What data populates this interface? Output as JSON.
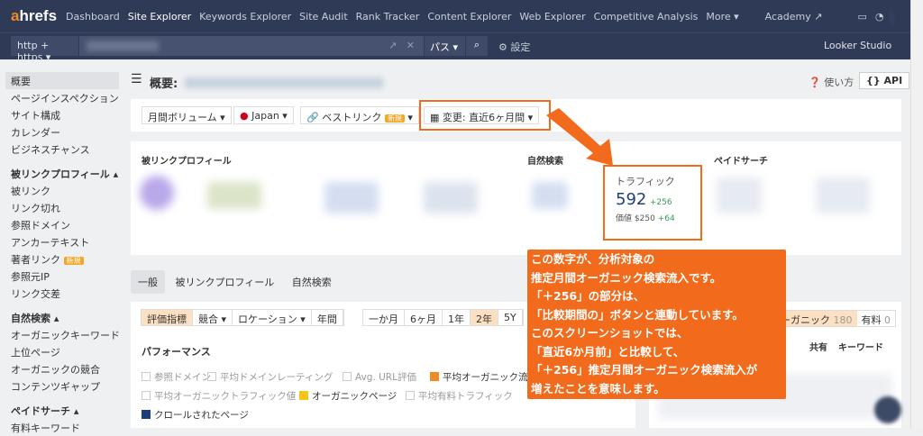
{
  "nav": {
    "logo_a": "a",
    "logo_rest": "hrefs",
    "items": [
      "Dashboard",
      "Site Explorer",
      "Keywords Explorer",
      "Site Audit",
      "Rank Tracker",
      "Content Explorer",
      "Web Explorer",
      "Competitive Analysis",
      "More ▾"
    ],
    "academy": "Academy ↗"
  },
  "search": {
    "protocol": "http + https ▾",
    "path": "パス ▾",
    "search_icon": "search-icon",
    "settings": "⚙ 設定",
    "looker": "Looker Studio"
  },
  "sidebar": {
    "items": [
      "概要",
      "ページインスペクション",
      "サイト構成",
      "カレンダー",
      "ビジネスチャンス"
    ],
    "backlinks_head": "被リンクプロフィール ▴",
    "backlinks": [
      "被リンク",
      "リンク切れ",
      "参照ドメイン",
      "アンカーテキスト",
      "著者リンク",
      "参照元IP",
      "リンク交差"
    ],
    "new_badge": "新規",
    "organic_head": "自然検索 ▴",
    "organic": [
      "オーガニックキーワード",
      "上位ページ",
      "オーガニックの競合",
      "コンテンツギャップ"
    ],
    "paid_head": "ペイドサーチ ▴",
    "paid": [
      "有料キーワード"
    ]
  },
  "header": {
    "title": "概要:",
    "help": "使い方",
    "api": "{} API"
  },
  "filters": {
    "volume": "月間ボリューム ▾",
    "country": "Japan ▾",
    "best_links": "ベストリンク",
    "best_badge": "新規",
    "compare": "変更: 直近6ヶ月間 ▾"
  },
  "cards": {
    "backlinks": "被リンクプロフィール",
    "organic": "自然検索",
    "paid": "ペイドサーチ",
    "traffic_label": "トラフィック",
    "traffic_value": "592",
    "traffic_delta": "+256",
    "value_label": "価値",
    "value_amount": "$250",
    "value_delta": "+64"
  },
  "callout": "この数字が、分析対象の\n推定月間オーガニック検索流入です。\n「＋256」の部分は、\n「比較期間の」ボタンと連動しています。\nこのスクリーンショットでは、\n「直近6か月前」と比較して、\n「＋256」推定月間オーガニック検索流入が\n増えたことを意味します。",
  "tabs": [
    "一般",
    "被リンクプロフィール",
    "自然検索"
  ],
  "controls": {
    "left": [
      "評価指標",
      "競合 ▾",
      "ロケーション ▾",
      "年間"
    ],
    "periods": [
      "一か月",
      "6ヶ月",
      "1年",
      "2年",
      "5Y"
    ],
    "active_period": "2年"
  },
  "performance": {
    "title": "パフォーマンス",
    "checks": [
      {
        "label": "参照ドメイン",
        "checked": false
      },
      {
        "label": "平均ドメインレーティング",
        "checked": false
      },
      {
        "label": "Avg. URL評価",
        "checked": false
      },
      {
        "label": "平均オーガニック流入",
        "checked": true
      },
      {
        "label": "平均オーガニックトラフィック値",
        "checked": false
      },
      {
        "label": "オーガニックページ",
        "checked": true
      },
      {
        "label": "平均有料トラフィック",
        "checked": false
      },
      {
        "label": "クロールされたページ",
        "checked": true
      }
    ]
  },
  "right_panel": {
    "organic_tab": "ーガニック",
    "organic_count": "180",
    "paid_tab": "有料",
    "paid_count": "0",
    "col_shared": "共有",
    "col_keyword": "キーワード"
  },
  "colors": {
    "accent": "#f26a1b",
    "nav_bg": "#2f3b56"
  }
}
